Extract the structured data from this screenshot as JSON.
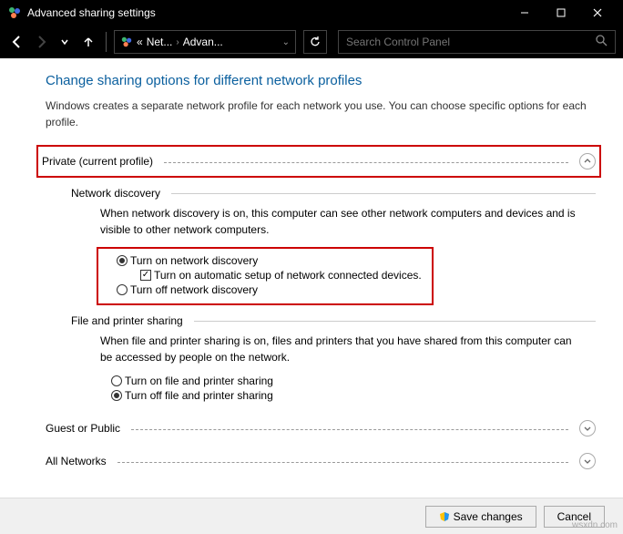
{
  "title": "Advanced sharing settings",
  "breadcrumb": {
    "b1": "Net...",
    "b2": "Advan..."
  },
  "search": {
    "placeholder": "Search Control Panel"
  },
  "heading": "Change sharing options for different network profiles",
  "subtext": "Windows creates a separate network profile for each network you use. You can choose specific options for each profile.",
  "section1": {
    "title": "Private (current profile)",
    "group1": {
      "title": "Network discovery",
      "desc": "When network discovery is on, this computer can see other network computers and devices and is visible to other network computers.",
      "opt1": "Turn on network discovery",
      "opt1sub": "Turn on automatic setup of network connected devices.",
      "opt2": "Turn off network discovery"
    },
    "group2": {
      "title": "File and printer sharing",
      "desc": "When file and printer sharing is on, files and printers that you have shared from this computer can be accessed by people on the network.",
      "opt1": "Turn on file and printer sharing",
      "opt2": "Turn off file and printer sharing"
    }
  },
  "section2": {
    "title": "Guest or Public"
  },
  "section3": {
    "title": "All Networks"
  },
  "buttons": {
    "save": "Save changes",
    "cancel": "Cancel"
  },
  "watermark": "wsxdn.com"
}
